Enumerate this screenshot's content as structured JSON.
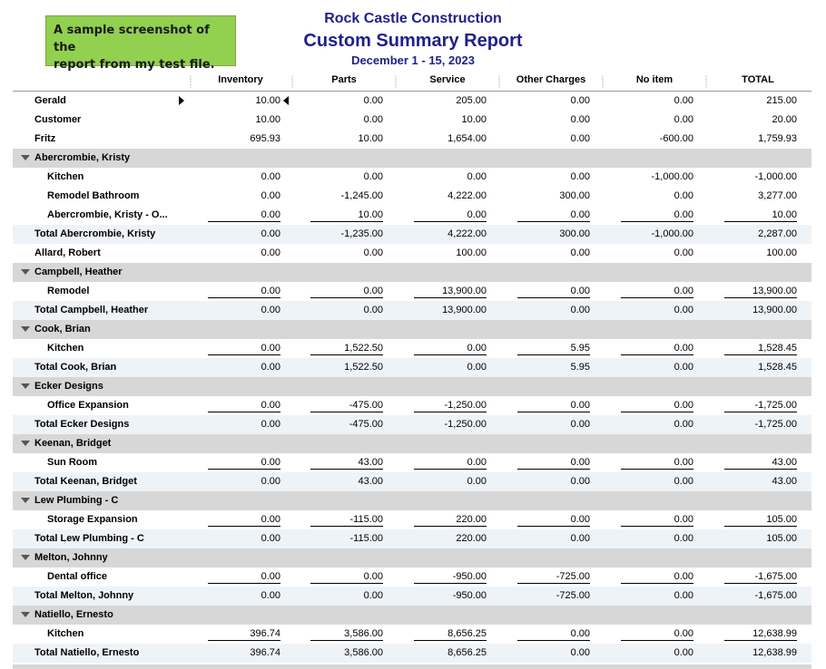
{
  "note": {
    "line1": "A sample screenshot of the",
    "line2": "report from my test file."
  },
  "report": {
    "company": "Rock Castle Construction",
    "title": "Custom Summary Report",
    "date_range": "December 1 - 15, 2023"
  },
  "columns": [
    "Inventory",
    "Parts",
    "Service",
    "Other Charges",
    "No item",
    "TOTAL"
  ],
  "rows": [
    {
      "type": "data",
      "indent": 0,
      "label": "Gerald",
      "values": [
        "10.00",
        "0.00",
        "205.00",
        "0.00",
        "0.00",
        "215.00"
      ],
      "marker": true
    },
    {
      "type": "data",
      "indent": 0,
      "label": "Customer",
      "values": [
        "10.00",
        "0.00",
        "10.00",
        "0.00",
        "0.00",
        "20.00"
      ]
    },
    {
      "type": "data",
      "indent": 0,
      "label": "Fritz",
      "values": [
        "695.93",
        "10.00",
        "1,654.00",
        "0.00",
        "-600.00",
        "1,759.93"
      ]
    },
    {
      "type": "group",
      "label": "Abercrombie, Kristy"
    },
    {
      "type": "data",
      "indent": 1,
      "label": "Kitchen",
      "values": [
        "0.00",
        "0.00",
        "0.00",
        "0.00",
        "-1,000.00",
        "-1,000.00"
      ]
    },
    {
      "type": "data",
      "indent": 1,
      "label": "Remodel Bathroom",
      "values": [
        "0.00",
        "-1,245.00",
        "4,222.00",
        "300.00",
        "0.00",
        "3,277.00"
      ]
    },
    {
      "type": "data",
      "indent": 1,
      "label": "Abercrombie, Kristy - O...",
      "values": [
        "0.00",
        "10.00",
        "0.00",
        "0.00",
        "0.00",
        "10.00"
      ],
      "underline": true
    },
    {
      "type": "total",
      "label": "Total Abercrombie, Kristy",
      "values": [
        "0.00",
        "-1,235.00",
        "4,222.00",
        "300.00",
        "-1,000.00",
        "2,287.00"
      ]
    },
    {
      "type": "data",
      "indent": 0,
      "label": "Allard, Robert",
      "values": [
        "0.00",
        "0.00",
        "100.00",
        "0.00",
        "0.00",
        "100.00"
      ]
    },
    {
      "type": "group",
      "label": "Campbell, Heather"
    },
    {
      "type": "data",
      "indent": 1,
      "label": "Remodel",
      "values": [
        "0.00",
        "0.00",
        "13,900.00",
        "0.00",
        "0.00",
        "13,900.00"
      ],
      "underline": true
    },
    {
      "type": "total",
      "label": "Total Campbell, Heather",
      "values": [
        "0.00",
        "0.00",
        "13,900.00",
        "0.00",
        "0.00",
        "13,900.00"
      ]
    },
    {
      "type": "group",
      "label": "Cook, Brian"
    },
    {
      "type": "data",
      "indent": 1,
      "label": "Kitchen",
      "values": [
        "0.00",
        "1,522.50",
        "0.00",
        "5.95",
        "0.00",
        "1,528.45"
      ],
      "underline": true
    },
    {
      "type": "total",
      "label": "Total Cook, Brian",
      "values": [
        "0.00",
        "1,522.50",
        "0.00",
        "5.95",
        "0.00",
        "1,528.45"
      ]
    },
    {
      "type": "group",
      "label": "Ecker Designs"
    },
    {
      "type": "data",
      "indent": 1,
      "label": "Office Expansion",
      "values": [
        "0.00",
        "-475.00",
        "-1,250.00",
        "0.00",
        "0.00",
        "-1,725.00"
      ],
      "underline": true
    },
    {
      "type": "total",
      "label": "Total Ecker Designs",
      "values": [
        "0.00",
        "-475.00",
        "-1,250.00",
        "0.00",
        "0.00",
        "-1,725.00"
      ]
    },
    {
      "type": "group",
      "label": "Keenan, Bridget"
    },
    {
      "type": "data",
      "indent": 1,
      "label": "Sun Room",
      "values": [
        "0.00",
        "43.00",
        "0.00",
        "0.00",
        "0.00",
        "43.00"
      ],
      "underline": true
    },
    {
      "type": "total",
      "label": "Total Keenan, Bridget",
      "values": [
        "0.00",
        "43.00",
        "0.00",
        "0.00",
        "0.00",
        "43.00"
      ]
    },
    {
      "type": "group",
      "label": "Lew Plumbing - C"
    },
    {
      "type": "data",
      "indent": 1,
      "label": "Storage Expansion",
      "values": [
        "0.00",
        "-115.00",
        "220.00",
        "0.00",
        "0.00",
        "105.00"
      ],
      "underline": true
    },
    {
      "type": "total",
      "label": "Total Lew Plumbing - C",
      "values": [
        "0.00",
        "-115.00",
        "220.00",
        "0.00",
        "0.00",
        "105.00"
      ]
    },
    {
      "type": "group",
      "label": "Melton, Johnny"
    },
    {
      "type": "data",
      "indent": 1,
      "label": "Dental office",
      "values": [
        "0.00",
        "0.00",
        "-950.00",
        "-725.00",
        "0.00",
        "-1,675.00"
      ],
      "underline": true
    },
    {
      "type": "total",
      "label": "Total Melton, Johnny",
      "values": [
        "0.00",
        "0.00",
        "-950.00",
        "-725.00",
        "0.00",
        "-1,675.00"
      ]
    },
    {
      "type": "group",
      "label": "Natiello, Ernesto"
    },
    {
      "type": "data",
      "indent": 1,
      "label": "Kitchen",
      "values": [
        "396.74",
        "3,586.00",
        "8,656.25",
        "0.00",
        "0.00",
        "12,638.99"
      ],
      "underline": true
    },
    {
      "type": "total",
      "label": "Total Natiello, Ernesto",
      "values": [
        "396.74",
        "3,586.00",
        "8,656.25",
        "0.00",
        "0.00",
        "12,638.99"
      ]
    }
  ]
}
